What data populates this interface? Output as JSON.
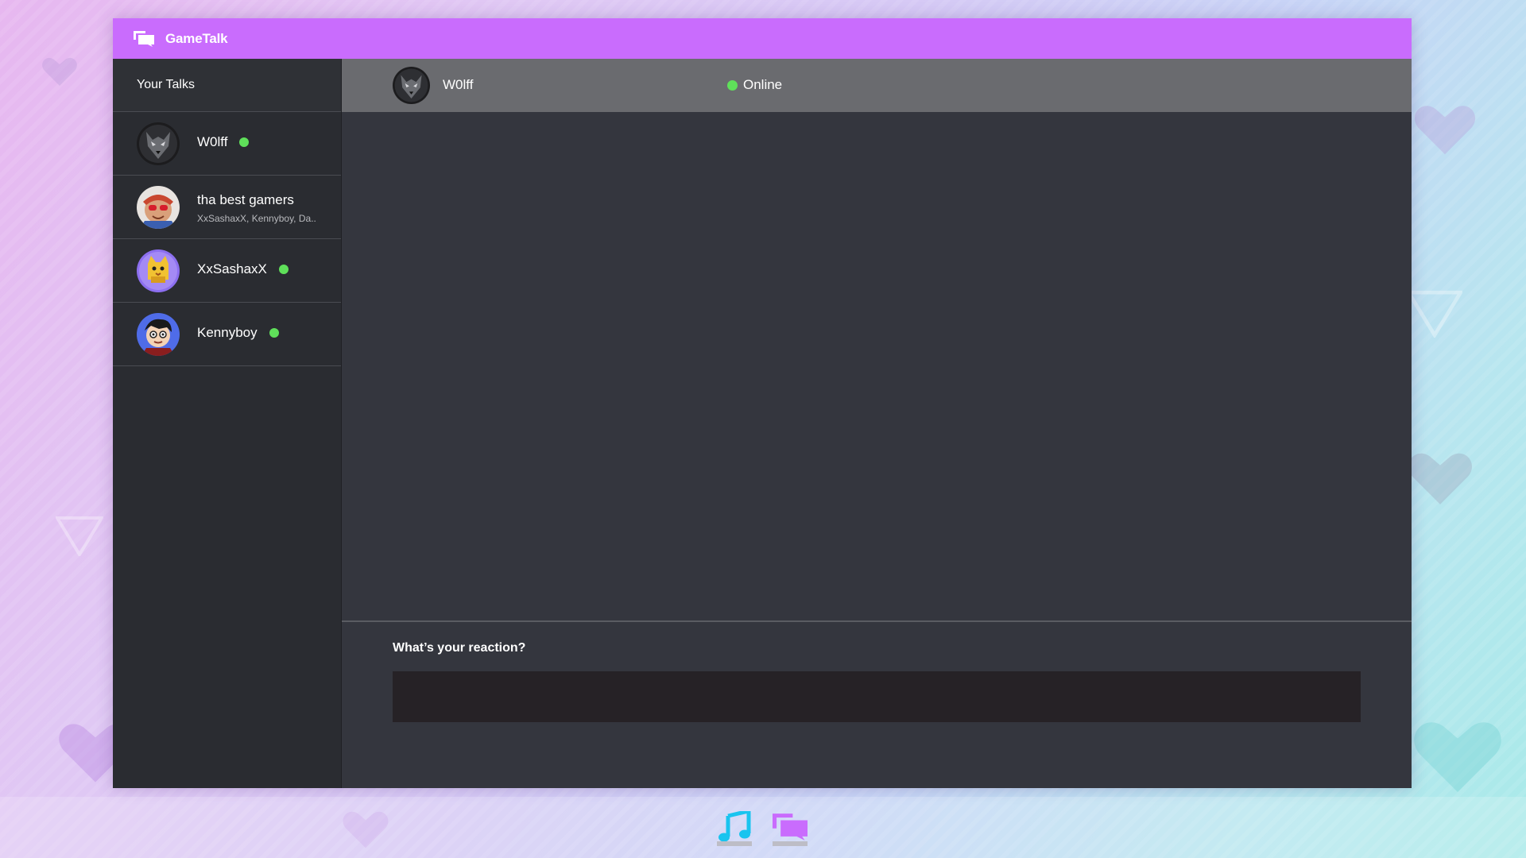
{
  "app": {
    "title": "GameTalk",
    "accent_color": "#c96cfd",
    "online_color": "#5fe05a"
  },
  "sidebar": {
    "header": "Your Talks",
    "items": [
      {
        "name": "W0lff",
        "online": true,
        "avatar": "wolf-avatar"
      },
      {
        "name": "tha best gamers",
        "members": "XxSashaxX, Kennyboy, Da..",
        "online": false,
        "avatar": "group-avatar"
      },
      {
        "name": "XxSashaxX",
        "online": true,
        "avatar": "cat-avatar"
      },
      {
        "name": "Kennyboy",
        "online": true,
        "avatar": "cartoon-boy-avatar"
      }
    ]
  },
  "chat": {
    "name": "W0lff",
    "status": "Online",
    "composer_label": "What’s your reaction?",
    "composer_value": ""
  },
  "taskbar": {
    "items": [
      {
        "icon": "music-note-icon",
        "color": "#19c4ef"
      },
      {
        "icon": "chat-bubbles-icon",
        "color": "#c96cfd"
      }
    ]
  }
}
